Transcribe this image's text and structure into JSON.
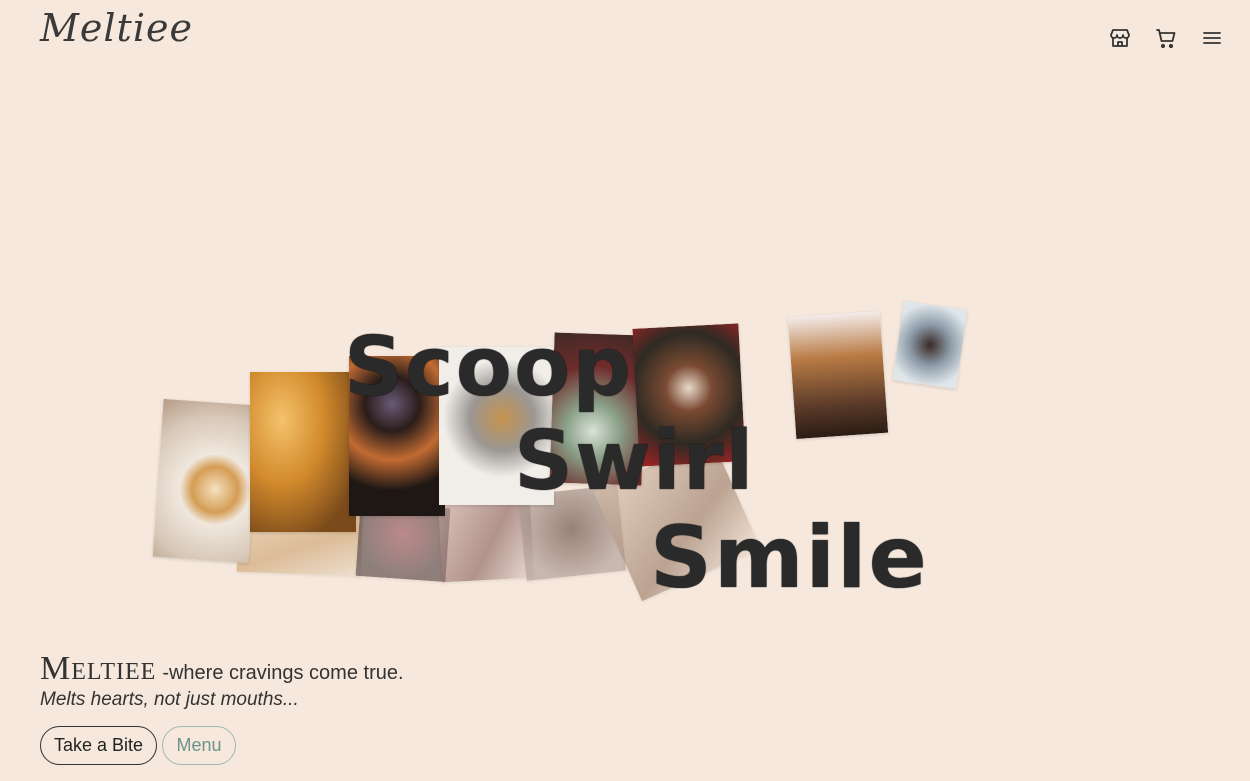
{
  "header": {
    "logo_text": "Meltiee",
    "icons": [
      {
        "name": "store-icon"
      },
      {
        "name": "cart-icon"
      },
      {
        "name": "menu-icon"
      }
    ]
  },
  "hero": {
    "words": [
      "Scoop",
      "Swirl",
      "Smile"
    ],
    "photos": [
      {
        "name": "cinnamon-rolls-photo",
        "color": "#d9c2a8"
      },
      {
        "name": "croissants-photo",
        "color": "#c8862f"
      },
      {
        "name": "donuts-photo",
        "color": "#3b2a22"
      },
      {
        "name": "cookies-photo",
        "color": "#e9e5df"
      },
      {
        "name": "mint-ice-cream-photo",
        "color": "#6b3f34"
      },
      {
        "name": "chocolate-cones-photo",
        "color": "#3d2a20"
      },
      {
        "name": "iced-latte-photo",
        "color": "#6a4a36"
      },
      {
        "name": "dessert-plate-photo",
        "color": "#8a9aa7"
      },
      {
        "name": "muffin-photo",
        "color": "#d9b88f"
      },
      {
        "name": "berry-tart-photo",
        "color": "#5a3c3e"
      },
      {
        "name": "cake-slice-photo",
        "color": "#8b6a66"
      },
      {
        "name": "chocolate-pastry-photo",
        "color": "#6e5850"
      }
    ]
  },
  "intro": {
    "brand": "Meltiee",
    "tagline": "-where cravings come true.",
    "subtagline": "Melts hearts, not just mouths..."
  },
  "actions": {
    "primary_label": "Take a Bite",
    "secondary_label": "Menu"
  }
}
